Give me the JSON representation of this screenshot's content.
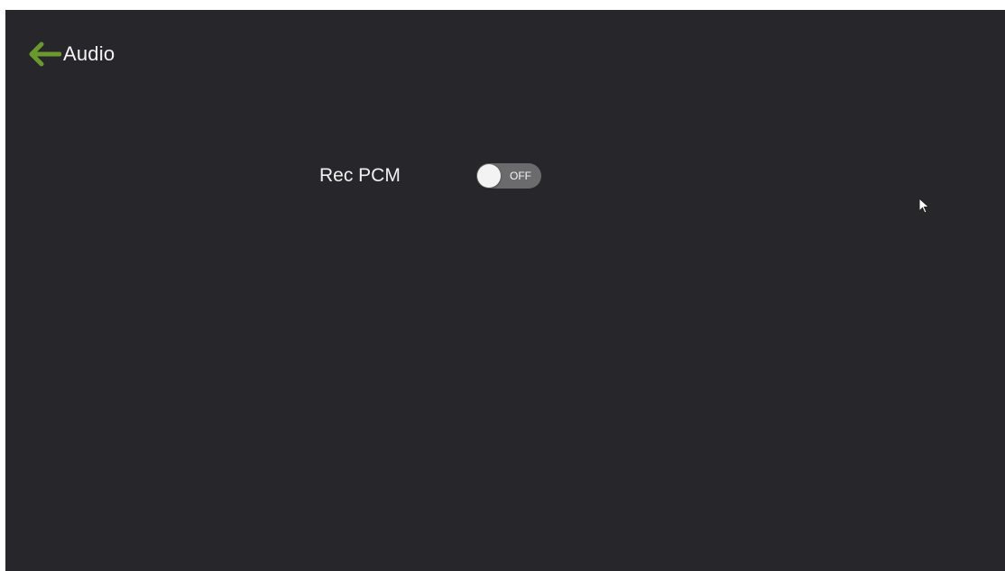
{
  "header": {
    "back_icon": "arrow-left-icon",
    "title": "Audio"
  },
  "settings": [
    {
      "label": "Rec PCM",
      "toggle_state": "OFF"
    }
  ],
  "colors": {
    "background": "#27272b",
    "accent_green": "#6a9a2c",
    "toggle_track": "#6b6b6e",
    "text": "#f2f2f2"
  }
}
